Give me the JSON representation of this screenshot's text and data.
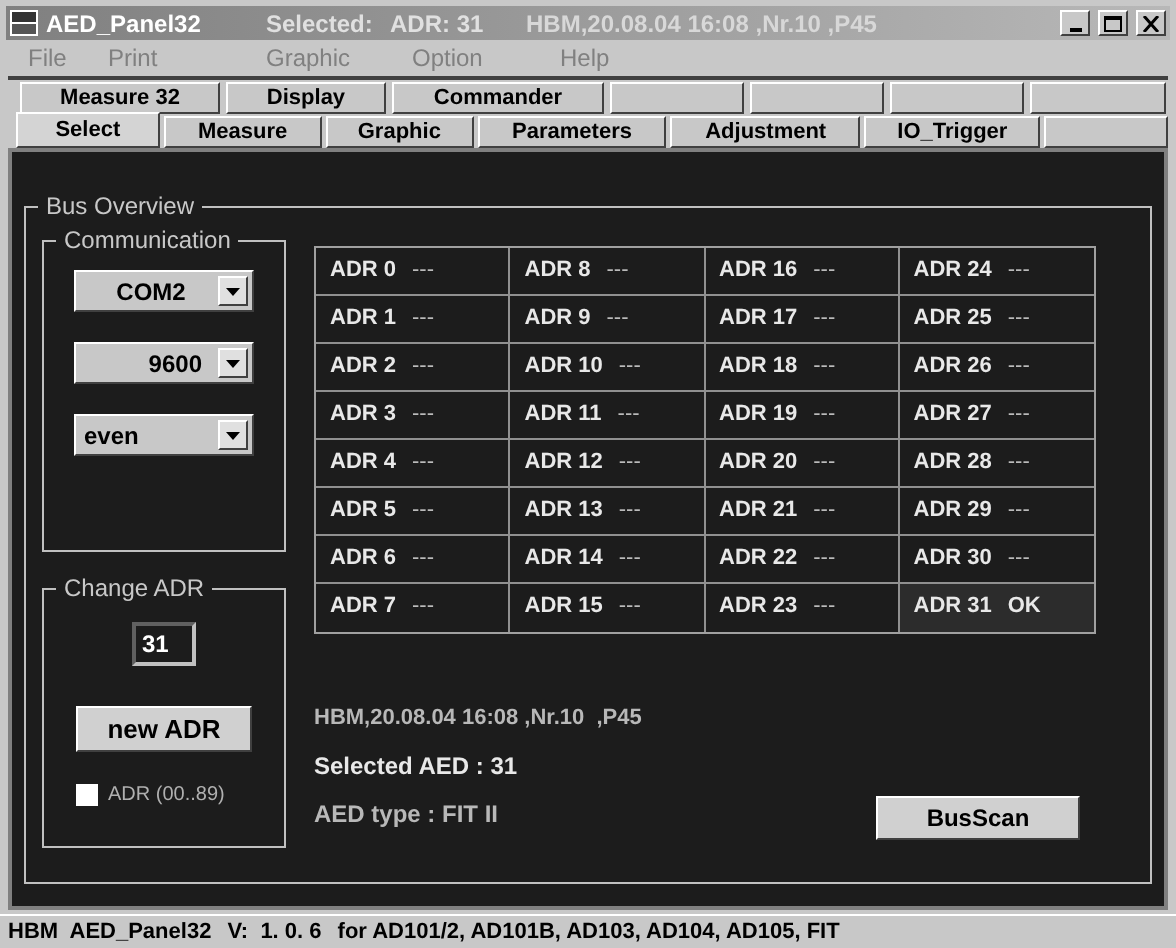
{
  "window": {
    "title": "AED_Panel32",
    "selected_label": "Selected:",
    "selected_adr": "ADR: 31",
    "device_info": "HBM,20.08.04 16:08 ,Nr.10  ,P45",
    "active": false
  },
  "menu": [
    "File",
    "Print",
    "Graphic",
    "Option",
    "Help"
  ],
  "tabs_row_1": [
    {
      "label": "Measure 32",
      "selected": false
    },
    {
      "label": "Display",
      "selected": false
    },
    {
      "label": "Commander",
      "selected": false
    }
  ],
  "tabs_row_2": [
    {
      "label": "Select",
      "selected": true
    },
    {
      "label": "Measure",
      "selected": false
    },
    {
      "label": "Graphic",
      "selected": false
    },
    {
      "label": "Parameters",
      "selected": false
    },
    {
      "label": "Adjustment",
      "selected": false
    },
    {
      "label": "IO_Trigger",
      "selected": false
    }
  ],
  "bus_overview": {
    "title": "Bus Overview",
    "communication": {
      "title": "Communication",
      "port": "COM2",
      "baud": "9600",
      "parity": "even"
    },
    "change_adr": {
      "title": "Change ADR",
      "value": "31",
      "button": "new ADR",
      "checkbox": {
        "label": "ADR (00..89)",
        "checked": false
      }
    },
    "grid_rows": [
      [
        {
          "label": "ADR 0",
          "status": "---",
          "selected": false
        },
        {
          "label": "ADR 8",
          "status": "---",
          "selected": false
        },
        {
          "label": "ADR 16",
          "status": "---",
          "selected": false
        },
        {
          "label": "ADR 24",
          "status": "---",
          "selected": false
        }
      ],
      [
        {
          "label": "ADR 1",
          "status": "---",
          "selected": false
        },
        {
          "label": "ADR 9",
          "status": "---",
          "selected": false
        },
        {
          "label": "ADR 17",
          "status": "---",
          "selected": false
        },
        {
          "label": "ADR 25",
          "status": "---",
          "selected": false
        }
      ],
      [
        {
          "label": "ADR 2",
          "status": "---",
          "selected": false
        },
        {
          "label": "ADR 10",
          "status": "---",
          "selected": false
        },
        {
          "label": "ADR 18",
          "status": "---",
          "selected": false
        },
        {
          "label": "ADR 26",
          "status": "---",
          "selected": false
        }
      ],
      [
        {
          "label": "ADR 3",
          "status": "---",
          "selected": false
        },
        {
          "label": "ADR 11",
          "status": "---",
          "selected": false
        },
        {
          "label": "ADR 19",
          "status": "---",
          "selected": false
        },
        {
          "label": "ADR 27",
          "status": "---",
          "selected": false
        }
      ],
      [
        {
          "label": "ADR 4",
          "status": "---",
          "selected": false
        },
        {
          "label": "ADR 12",
          "status": "---",
          "selected": false
        },
        {
          "label": "ADR 20",
          "status": "---",
          "selected": false
        },
        {
          "label": "ADR 28",
          "status": "---",
          "selected": false
        }
      ],
      [
        {
          "label": "ADR 5",
          "status": "---",
          "selected": false
        },
        {
          "label": "ADR 13",
          "status": "---",
          "selected": false
        },
        {
          "label": "ADR 21",
          "status": "---",
          "selected": false
        },
        {
          "label": "ADR 29",
          "status": "---",
          "selected": false
        }
      ],
      [
        {
          "label": "ADR 6",
          "status": "---",
          "selected": false
        },
        {
          "label": "ADR 14",
          "status": "---",
          "selected": false
        },
        {
          "label": "ADR 22",
          "status": "---",
          "selected": false
        },
        {
          "label": "ADR 30",
          "status": "---",
          "selected": false
        }
      ],
      [
        {
          "label": "ADR 7",
          "status": "---",
          "selected": false
        },
        {
          "label": "ADR 15",
          "status": "---",
          "selected": false
        },
        {
          "label": "ADR 23",
          "status": "---",
          "selected": false
        },
        {
          "label": "ADR 31",
          "status": "OK",
          "selected": true
        }
      ]
    ],
    "device_info": "HBM,20.08.04 16:08 ,Nr.10  ,P45",
    "selected_aed": "Selected AED : 31",
    "aed_type": "AED type : FIT II",
    "scan_button": "BusScan"
  },
  "status_bar": {
    "app": "HBM  AED_Panel32",
    "version": "V:  1. 0. 6",
    "devices": "for AD101/2, AD101B, AD103, AD104, AD105, FIT"
  }
}
